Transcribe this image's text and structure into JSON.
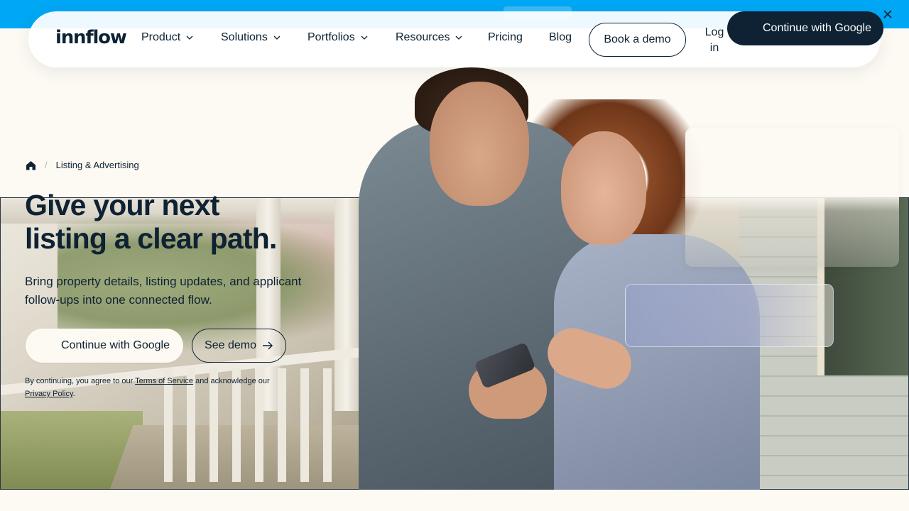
{
  "announcement": {
    "close_icon": "close-icon",
    "bg_color": "#00a7f4"
  },
  "header": {
    "logo": "innflow",
    "nav": [
      {
        "label": "Product",
        "has_dropdown": true
      },
      {
        "label": "Solutions",
        "has_dropdown": true
      },
      {
        "label": "Portfolios",
        "has_dropdown": true
      },
      {
        "label": "Resources",
        "has_dropdown": true
      },
      {
        "label": "Pricing",
        "has_dropdown": false
      },
      {
        "label": "Blog",
        "has_dropdown": false
      }
    ],
    "book_demo": "Book a demo",
    "login": "Log in",
    "google_cta": "Continue with Google"
  },
  "breadcrumb": {
    "home_icon": "home-icon",
    "current": "Listing & Advertising"
  },
  "hero": {
    "headline_line1": "Give your next",
    "headline_line2": "listing a clear path.",
    "subtext": "Bring property details, listing updates, and applicant follow-ups into one connected flow.",
    "google_cta": "Continue with Google",
    "demo_cta": "See demo",
    "legal_prefix": "By continuing, you agree to our ",
    "terms_link": "Terms of Service",
    "legal_middle": " and acknowledge our ",
    "privacy_link": "Privacy Policy",
    "legal_suffix": "."
  },
  "colors": {
    "navy": "#0e2233",
    "cream": "#fdf9f3",
    "accent_blue": "#00a7f4"
  }
}
